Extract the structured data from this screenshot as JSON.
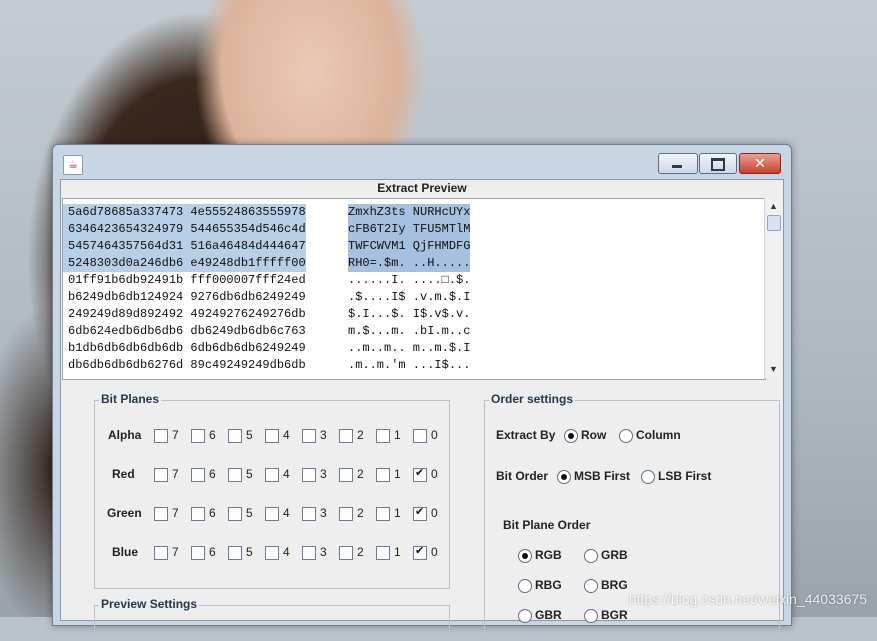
{
  "window": {
    "title": "Extract Preview"
  },
  "preview": {
    "rows": [
      {
        "hex": "5a6d78685a337473 4e55524863555978",
        "ascii": "ZmxhZ3ts NURHcUYx"
      },
      {
        "hex": "6346423654324979 544655354d546c4d",
        "ascii": "cFB6T2Iy TFU5MTlM"
      },
      {
        "hex": "5457464357564d31 516a46484d444647",
        "ascii": "TWFCWVM1 QjFHMDFG"
      },
      {
        "hex": "5248303d0a246db6 e49248db1fffff00",
        "ascii": "RH0=.$m. ..H....."
      },
      {
        "hex": "01ff91b6db92491b fff000007fff24ed",
        "ascii": "......I. ....□.$."
      },
      {
        "hex": "b6249db6db124924 9276db6db6249249",
        "ascii": ".$....I$ .v.m.$.I"
      },
      {
        "hex": "249249d89d892492 49249276249276db",
        "ascii": "$.I...$. I$.v$.v."
      },
      {
        "hex": "6db624edb6db6db6 db6249db6db6c763",
        "ascii": "m.$...m. .bI.m..c"
      },
      {
        "hex": "b1db6db6db6db6db 6db6db6db6249249",
        "ascii": "..m..m.. m..m.$.I"
      },
      {
        "hex": "db6db6db6db6276d 89c49249249db6db",
        "ascii": ".m..m.'m ...I$..."
      }
    ]
  },
  "bit_planes": {
    "title": "Bit Planes",
    "channels": [
      {
        "name": "Alpha",
        "checked": []
      },
      {
        "name": "Red",
        "checked": [
          "0"
        ]
      },
      {
        "name": "Green",
        "checked": [
          "0"
        ]
      },
      {
        "name": "Blue",
        "checked": [
          "0"
        ]
      }
    ],
    "bits": [
      "7",
      "6",
      "5",
      "4",
      "3",
      "2",
      "1",
      "0"
    ]
  },
  "order_settings": {
    "title": "Order settings",
    "extract_by": {
      "label": "Extract By",
      "options": [
        "Row",
        "Column"
      ],
      "selected": "Row"
    },
    "bit_order": {
      "label": "Bit Order",
      "options": [
        "MSB First",
        "LSB First"
      ],
      "selected": "MSB First"
    },
    "bit_plane_order": {
      "label": "Bit Plane Order",
      "options": [
        "RGB",
        "GRB",
        "RBG",
        "BRG",
        "GBR",
        "BGR"
      ],
      "selected": "RGB"
    }
  },
  "preview_settings": {
    "title": "Preview Settings"
  },
  "watermark": "https://blog.csdn.net/weixin_44033675"
}
